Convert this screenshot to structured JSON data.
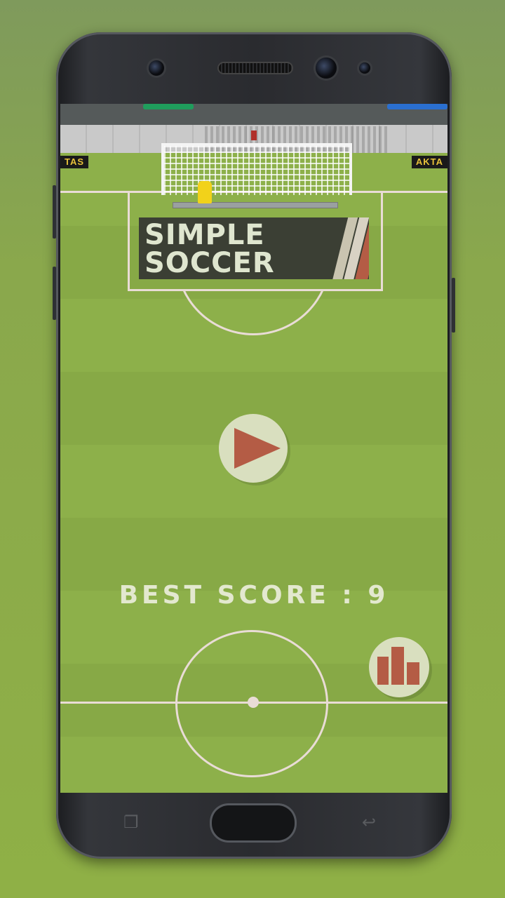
{
  "app": {
    "title_line1": "SIMPLE",
    "title_line2": "SOCCER"
  },
  "hud": {
    "best_score_label": "BEST SCORE : 9"
  },
  "ad_boards": {
    "left": "TAS",
    "right": "AKTA"
  },
  "buttons": {
    "play_icon": "play-icon",
    "leaderboard_icon": "leaderboard-icon"
  },
  "colors": {
    "field_light": "#8db04a",
    "field_dark": "#87a946",
    "field_lines": "#e9dcd6",
    "logo_bg": "#3b3f34",
    "logo_text": "#dfe6cf",
    "accent_red": "#b45c45",
    "button_bg": "#d9dfbf",
    "keeper": "#f2d21a"
  }
}
